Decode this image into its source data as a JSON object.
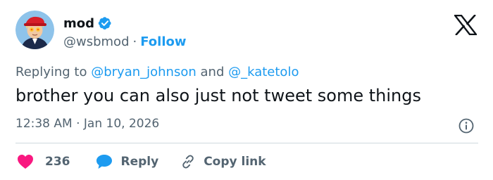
{
  "author": {
    "name": "mod",
    "handle": "@wsbmod",
    "separator": "·",
    "follow_label": "Follow",
    "verified_icon": "verified-badge-icon",
    "avatar_icon": "avatar"
  },
  "reply_context": {
    "prefix": "Replying to",
    "mention_1": "@bryan_johnson",
    "conjunction": "and",
    "mention_2": "@_katetolo"
  },
  "tweet": {
    "text": "brother you can also just not tweet some things",
    "timestamp": "12:38 AM · Jan 10, 2026"
  },
  "actions": {
    "like_count": "236",
    "reply_label": "Reply",
    "copy_link_label": "Copy link"
  },
  "icons": {
    "brand": "x-logo-icon",
    "info": "info-icon",
    "like": "heart-icon",
    "reply": "speech-bubble-icon",
    "copy": "link-icon"
  },
  "colors": {
    "accent": "#1d9bf0",
    "text_primary": "#0f1419",
    "text_secondary": "#536471",
    "like": "#f91880",
    "reply": "#1d9bf0",
    "divider": "#cfd9de"
  }
}
